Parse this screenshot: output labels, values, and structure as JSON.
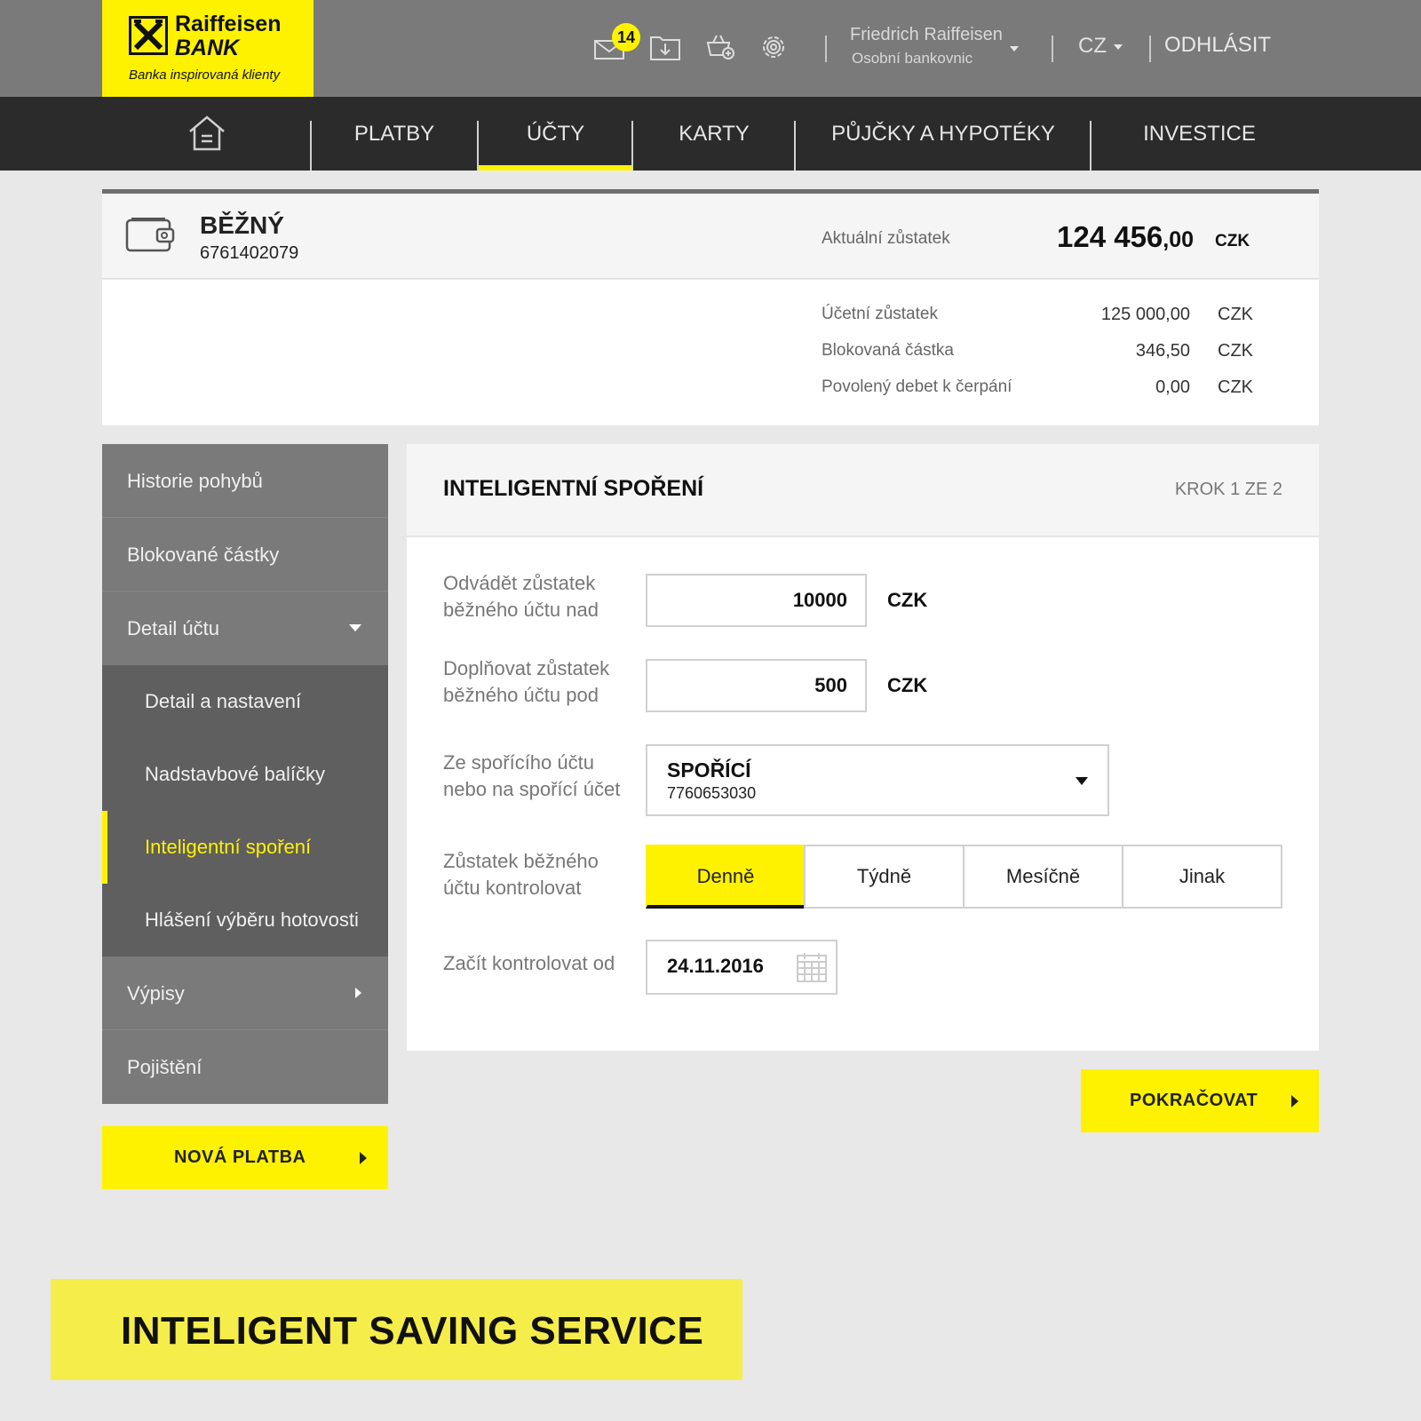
{
  "brand": {
    "name": "Raiffeisen",
    "bank": "BANK",
    "tagline": "Banka inspirovaná klienty",
    "yellow": "#fff200"
  },
  "header": {
    "messages_badge": "14",
    "icons": [
      "mail-icon",
      "download-icon",
      "cart-add-icon",
      "gear-icon"
    ],
    "user_name": "Friedrich Raiffeisen",
    "user_role": "Osobní bankovnic",
    "language": "CZ",
    "logout": "ODHLÁSIT"
  },
  "nav": {
    "items": [
      "PLATBY",
      "ÚČTY",
      "KARTY",
      "PŮJČKY A HYPOTÉKY",
      "INVESTICE"
    ],
    "active": "ÚČTY"
  },
  "account": {
    "name": "BĚŽNÝ",
    "number": "6761402079",
    "current_label": "Aktuální zůstatek",
    "current_main": "124 456",
    "current_decimals": ",00",
    "currency": "CZK",
    "balances": [
      {
        "label": "Účetní zůstatek",
        "value": "125 000,00",
        "currency": "CZK"
      },
      {
        "label": "Blokovaná částka",
        "value": "346,50",
        "currency": "CZK"
      },
      {
        "label": "Povolený debet k čerpání",
        "value": "0,00",
        "currency": "CZK"
      }
    ]
  },
  "sidebar": {
    "items": [
      "Historie pohybů",
      "Blokované částky",
      "Detail účtu",
      "Detail a nastavení",
      "Nadstavbové balíčky",
      "Inteligentní spoření",
      "Hlášení výběru hotovosti",
      "Výpisy",
      "Pojištění"
    ],
    "new_payment": "NOVÁ PLATBA"
  },
  "panel": {
    "title": "INTELIGENTNÍ SPOŘENÍ",
    "step": "KROK 1 ZE 2",
    "field1_label": "Odvádět zůstatek běžného účtu nad",
    "field1_value": "10000",
    "field1_currency": "CZK",
    "field2_label": "Doplňovat zůstatek běžného účtu pod",
    "field2_value": "500",
    "field2_currency": "CZK",
    "field3_label": "Ze spořícího účtu nebo na spořící účet",
    "savings_name": "SPOŘÍCÍ",
    "savings_number": "7760653030",
    "field4_label": "Zůstatek běžného účtu kontrolovat",
    "frequency_options": [
      "Denně",
      "Týdně",
      "Mesíčně",
      "Jinak"
    ],
    "frequency_selected": "Denně",
    "field5_label": "Začít kontrolovat od",
    "start_date": "24.11.2016",
    "continue": "POKRAČOVAT"
  },
  "caption": "INTELIGENT SAVING SERVICE"
}
